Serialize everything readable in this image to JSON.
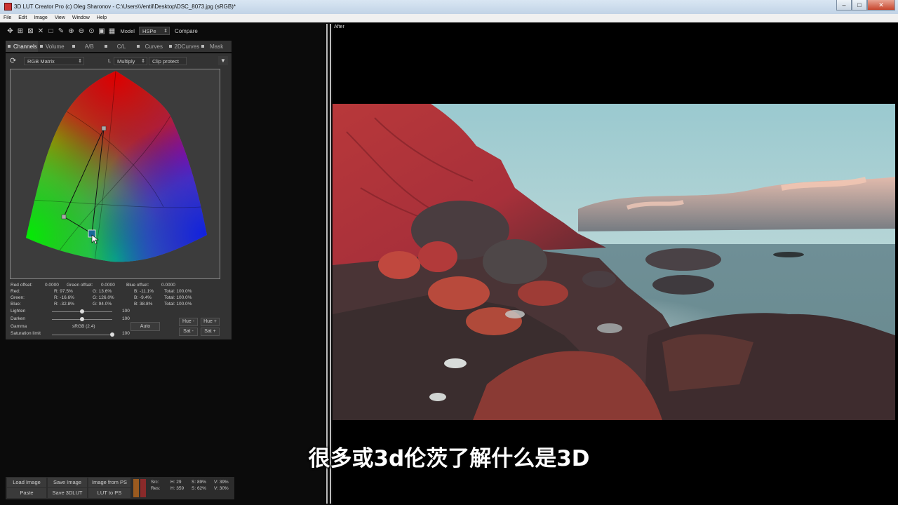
{
  "window": {
    "title": "3D LUT Creator Pro (c) Oleg Sharonov - C:\\Users\\Ventil\\Desktop\\DSC_8073.jpg (sRGB)*"
  },
  "window_controls": [
    "–",
    "□",
    "✕"
  ],
  "menu": [
    "File",
    "Edit",
    "Image",
    "View",
    "Window",
    "Help"
  ],
  "toolbar": {
    "icons": [
      "move-icon",
      "grid-icon",
      "grid-cross-icon",
      "cross-icon",
      "select-icon",
      "eyedropper-icon",
      "zoom-in-icon",
      "zoom-out-icon",
      "zoom-fit-icon",
      "frame-icon",
      "grid-view-icon"
    ],
    "model_label": "Model",
    "model_value": "HSPe",
    "compare_label": "Compare"
  },
  "tabs": [
    "Channels",
    "Volume",
    "A/B",
    "C/L",
    "Curves",
    "2DCurves",
    "Mask"
  ],
  "active_tab": "Channels",
  "subbar": {
    "mode": "RGB Matrix",
    "l_label": "L",
    "blend": "Multiply",
    "clip": "Clip protect"
  },
  "offsets": {
    "red_label": "Red offset:",
    "red_value": "0.0000",
    "green_label": "Green offset:",
    "green_value": "0.0000",
    "blue_label": "Blue offset:",
    "blue_value": "0.0000"
  },
  "matrix": [
    {
      "label": "Red:",
      "r": "R: 97.5%",
      "g": "G: 13.6%",
      "b": "B: -11.1%",
      "total": "Total: 100.0%"
    },
    {
      "label": "Green:",
      "r": "R: -16.6%",
      "g": "G: 126.0%",
      "b": "B: -9.4%",
      "total": "Total: 100.0%"
    },
    {
      "label": "Blue:",
      "r": "R: -32.8%",
      "g": "G: 94.0%",
      "b": "B: 38.8%",
      "total": "Total: 100.0%"
    }
  ],
  "controls": {
    "lighten_label": "Lighten",
    "lighten_value": "100",
    "lighten_level": 0.5,
    "darken_label": "Darken",
    "darken_value": "100",
    "darken_level": 0.5,
    "gamma_label": "Gamma",
    "gamma_value": "sRGB (2.4)",
    "auto_label": "Auto",
    "saturation_label": "Saturation limit",
    "saturation_value": "100",
    "saturation_level": 1.0,
    "hue_minus": "Hue -",
    "hue_plus": "Hue +",
    "sat_minus": "Sat -",
    "sat_plus": "Sat +"
  },
  "bottom": {
    "load_image": "Load Image",
    "save_image": "Save Image",
    "image_from_ps": "Image from PS",
    "paste": "Paste",
    "save_3dlut": "Save 3DLUT",
    "lut_to_ps": "LUT to PS",
    "src_label": "Src:",
    "src_h": "H: 29",
    "src_s": "S: 89%",
    "src_v": "V: 39%",
    "res_label": "Res:",
    "res_h": "H: 359",
    "res_s": "S: 62%",
    "res_v": "V: 30%",
    "src_color": "#9a5a1f",
    "res_color": "#8a2a2a"
  },
  "viewer": {
    "label": "After"
  },
  "subtitle": "很多或3d伦茨了解什么是3D"
}
